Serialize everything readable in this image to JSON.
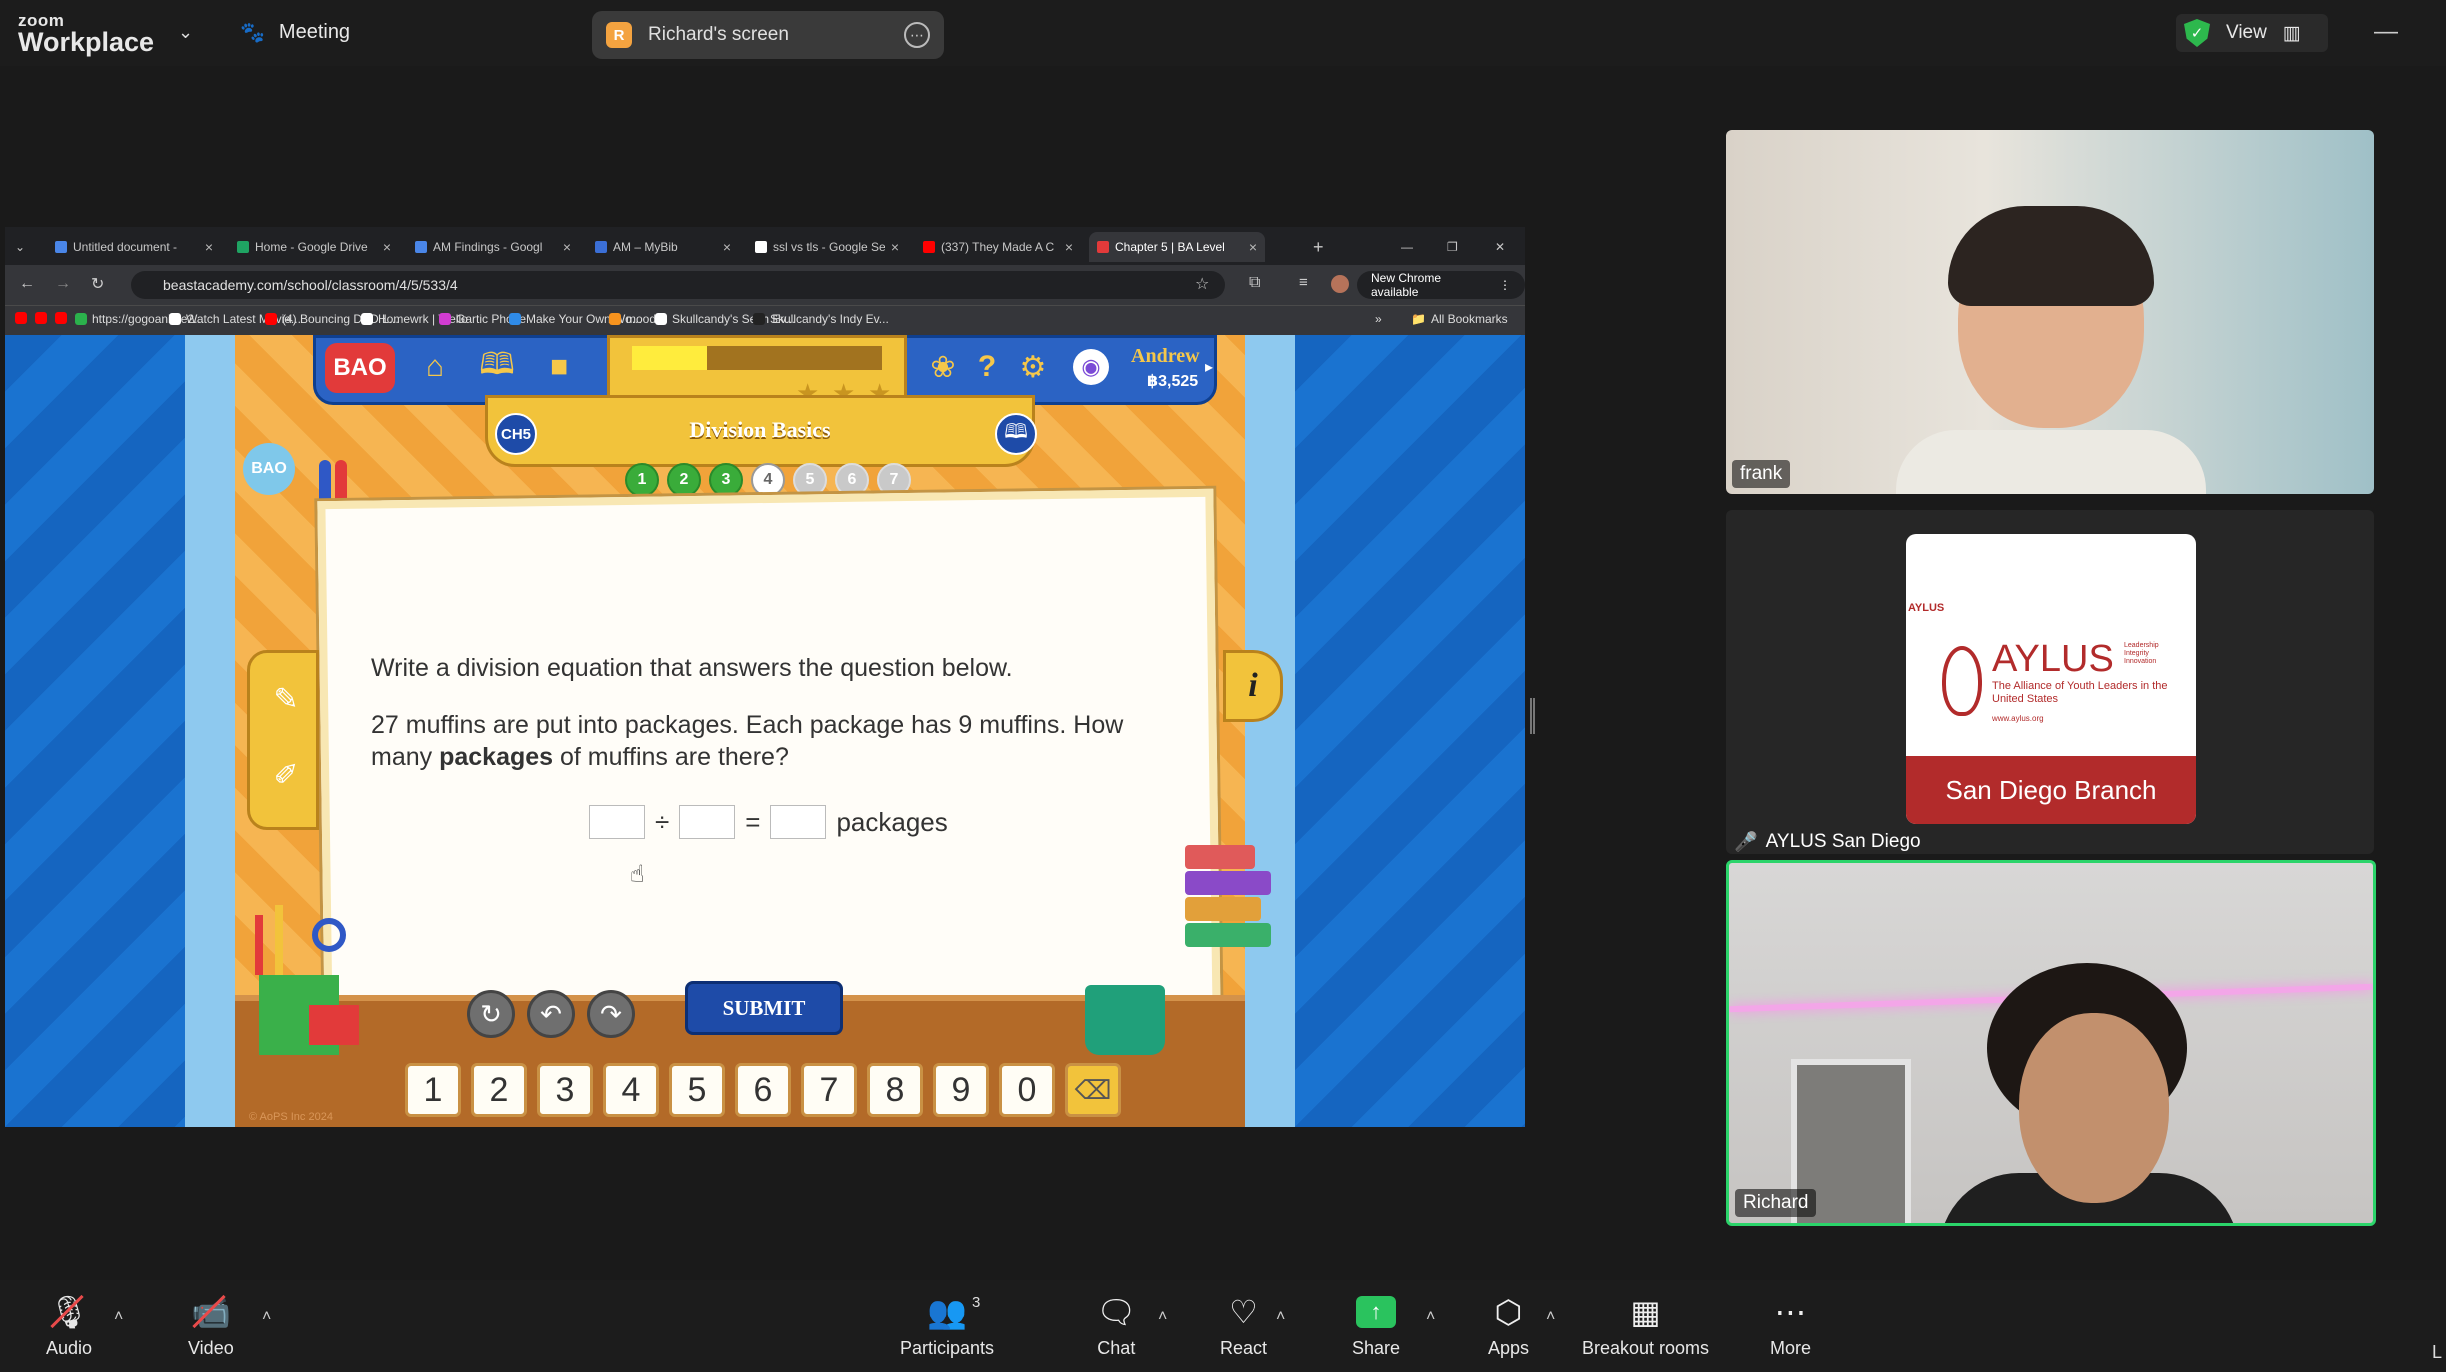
{
  "zoom": {
    "logo_small": "zoom",
    "logo_big": "Workplace",
    "meeting_label": "Meeting",
    "screen_share_initial": "R",
    "screen_share_label": "Richard's screen",
    "view_label": "View",
    "accent_green": "#2bd46a"
  },
  "browser": {
    "tabs": [
      {
        "label": "Untitled document -",
        "color": "#4a86e8"
      },
      {
        "label": "Home - Google Drive",
        "color": "#1fa463"
      },
      {
        "label": "AM Findings - Googl",
        "color": "#4a86e8"
      },
      {
        "label": "AM – MyBib",
        "color": "#3b6fd6"
      },
      {
        "label": "ssl vs tls - Google Se",
        "color": "#ffffff"
      },
      {
        "label": "(337) They Made A C",
        "color": "#ff0000"
      },
      {
        "label": "Chapter 5 | BA Level",
        "color": "#e23a3a"
      }
    ],
    "url": "beastacademy.com/school/classroom/4/5/533/4",
    "new_chrome": "New Chrome available",
    "bookmarks": [
      {
        "label": "https://gogoanime2...",
        "color": "#2bb24c"
      },
      {
        "label": "Watch Latest Movie...",
        "color": "#ffffff"
      },
      {
        "label": "(4) Bouncing DVD L...",
        "color": "#ff0000"
      },
      {
        "label": "Homewrk | Trello",
        "color": "#ffffff"
      },
      {
        "label": "Gartic Phone",
        "color": "#d23cd2"
      },
      {
        "label": "Make Your Own Wo...",
        "color": "#2f8be8"
      },
      {
        "label": "moodle",
        "color": "#f7931e"
      },
      {
        "label": "Skullcandy's Sesh Ev...",
        "color": "#ffffff"
      },
      {
        "label": "Skullcandy's Indy Ev...",
        "color": "#222222"
      }
    ],
    "all_bookmarks": "All Bookmarks"
  },
  "game": {
    "logo": "BAO",
    "user_name": "Andrew",
    "coins": "฿3,525",
    "progress_fraction": 0.3,
    "chapter_badge": "CH5",
    "lesson_title": "Division Basics",
    "side_logo": "BAO",
    "steps": [
      {
        "n": "1",
        "state": "done"
      },
      {
        "n": "2",
        "state": "done"
      },
      {
        "n": "3",
        "state": "done"
      },
      {
        "n": "4",
        "state": "current"
      },
      {
        "n": "5",
        "state": "todo"
      },
      {
        "n": "6",
        "state": "todo"
      },
      {
        "n": "7",
        "state": "todo"
      }
    ],
    "question_line1": "Write a division equation that answers the question below.",
    "question_pre": "27 muffins are put into packages. Each package has 9 muffins. How many ",
    "question_bold": "packages",
    "question_post": " of muffins are there?",
    "eq_div": "÷",
    "eq_equals": "=",
    "eq_unit": "packages",
    "submit": "SUBMIT",
    "keys": [
      "1",
      "2",
      "3",
      "4",
      "5",
      "6",
      "7",
      "8",
      "9",
      "0"
    ],
    "copyright": "© AoPS Inc 2024"
  },
  "participants": {
    "frank": "frank",
    "aylus_label": "AYLUS San Diego",
    "richard": "Richard",
    "aylus_card": {
      "top": "AYLUS",
      "name": "AYLUS",
      "tagline": "Leadership Integrity Innovation",
      "subtitle": "The Alliance of Youth Leaders in the United States",
      "url": "www.aylus.org",
      "band": "San Diego Branch"
    }
  },
  "toolbar": {
    "audio": "Audio",
    "video": "Video",
    "participants": "Participants",
    "participants_count": "3",
    "chat": "Chat",
    "react": "React",
    "share": "Share",
    "apps": "Apps",
    "breakout": "Breakout rooms",
    "more": "More",
    "clipped": "L"
  }
}
